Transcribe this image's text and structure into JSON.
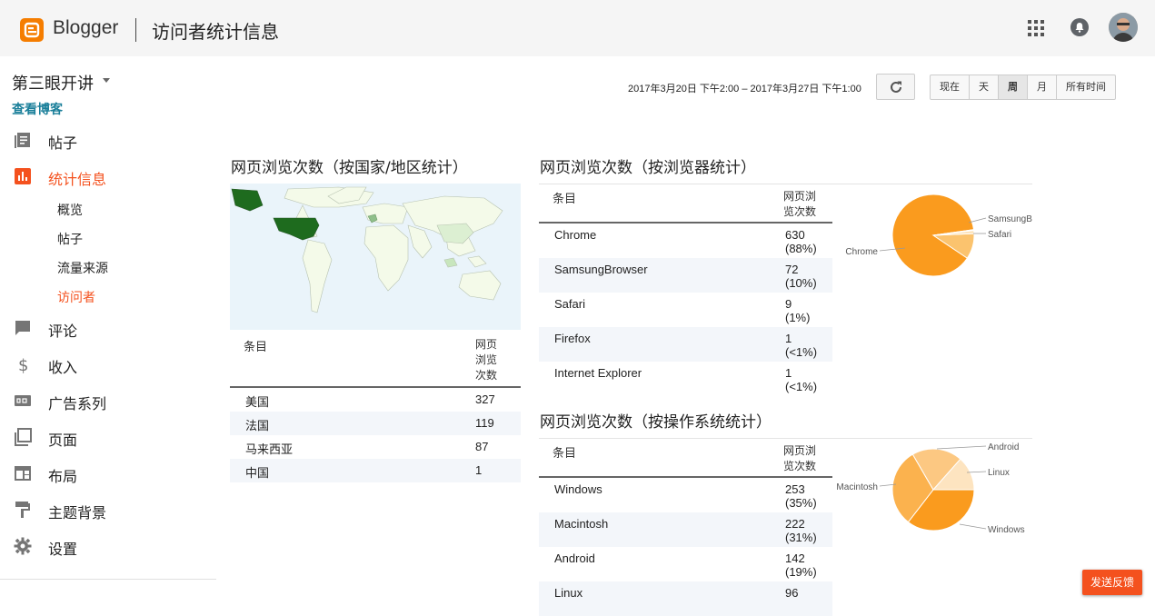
{
  "header": {
    "brand": "Blogger",
    "title": "访问者统计信息"
  },
  "sidebar": {
    "blog_name": "第三眼开讲",
    "view_blog": "查看博客",
    "items": [
      {
        "label": "帖子",
        "icon": "posts-icon"
      },
      {
        "label": "统计信息",
        "icon": "stats-icon"
      },
      {
        "label": "评论",
        "icon": "comment-icon"
      },
      {
        "label": "收入",
        "icon": "dollar-icon"
      },
      {
        "label": "广告系列",
        "icon": "ad-icon"
      },
      {
        "label": "页面",
        "icon": "pages-icon"
      },
      {
        "label": "布局",
        "icon": "layout-icon"
      },
      {
        "label": "主题背景",
        "icon": "theme-icon"
      },
      {
        "label": "设置",
        "icon": "gear-icon"
      }
    ],
    "stats_sub": [
      "概览",
      "帖子",
      "流量来源",
      "访问者"
    ]
  },
  "toolbar": {
    "date_range": "2017年3月20日 下午2:00 – 2017年3月27日 下午1:00",
    "ranges": [
      "现在",
      "天",
      "周",
      "月",
      "所有时间"
    ],
    "selected_range": "周"
  },
  "country_panel": {
    "title": "网页浏览次数（按国家/地区统计）",
    "col_entry": "条目",
    "col_views": "网页\n浏览\n次数",
    "rows": [
      {
        "name": "美国",
        "views": "327"
      },
      {
        "name": "法国",
        "views": "119"
      },
      {
        "name": "马来西亚",
        "views": "87"
      },
      {
        "name": "中国",
        "views": "1"
      }
    ]
  },
  "browser_panel": {
    "title": "网页浏览次数（按浏览器统计）",
    "col_entry": "条目",
    "col_views": "网页浏\n览次数",
    "rows": [
      {
        "name": "Chrome",
        "views": "630\n(88%)"
      },
      {
        "name": "SamsungBrowser",
        "views": "72\n(10%)"
      },
      {
        "name": "Safari",
        "views": "9\n(1%)"
      },
      {
        "name": "Firefox",
        "views": "1\n(<1%)"
      },
      {
        "name": "Internet Explorer",
        "views": "1\n(<1%)"
      }
    ],
    "pie_labels": [
      "Chrome",
      "SamsungB",
      "Safari"
    ]
  },
  "os_panel": {
    "title": "网页浏览次数（按操作系统统计）",
    "col_entry": "条目",
    "col_views": "网页浏\n览次数",
    "rows": [
      {
        "name": "Windows",
        "views": "253\n(35%)"
      },
      {
        "name": "Macintosh",
        "views": "222\n(31%)"
      },
      {
        "name": "Android",
        "views": "142\n(19%)"
      },
      {
        "name": "Linux",
        "views": "96"
      }
    ],
    "pie_labels": [
      "Macintosh",
      "Android",
      "Linux",
      "Windows"
    ]
  },
  "chart_data": [
    {
      "type": "pie",
      "categories": [
        "Chrome",
        "SamsungBrowser",
        "Safari",
        "Firefox",
        "Internet Explorer"
      ],
      "values": [
        630,
        72,
        9,
        1,
        1
      ],
      "colors": [
        "#fa9b1e",
        "#fbc36e",
        "#fde2b8",
        "#fde2b8",
        "#fde2b8"
      ]
    },
    {
      "type": "pie",
      "categories": [
        "Windows",
        "Macintosh",
        "Android",
        "Linux"
      ],
      "values": [
        253,
        222,
        142,
        96
      ],
      "colors": [
        "#fa9b1e",
        "#fbb24e",
        "#fcc882",
        "#fde4c0"
      ]
    }
  ],
  "feedback": "发送反馈"
}
